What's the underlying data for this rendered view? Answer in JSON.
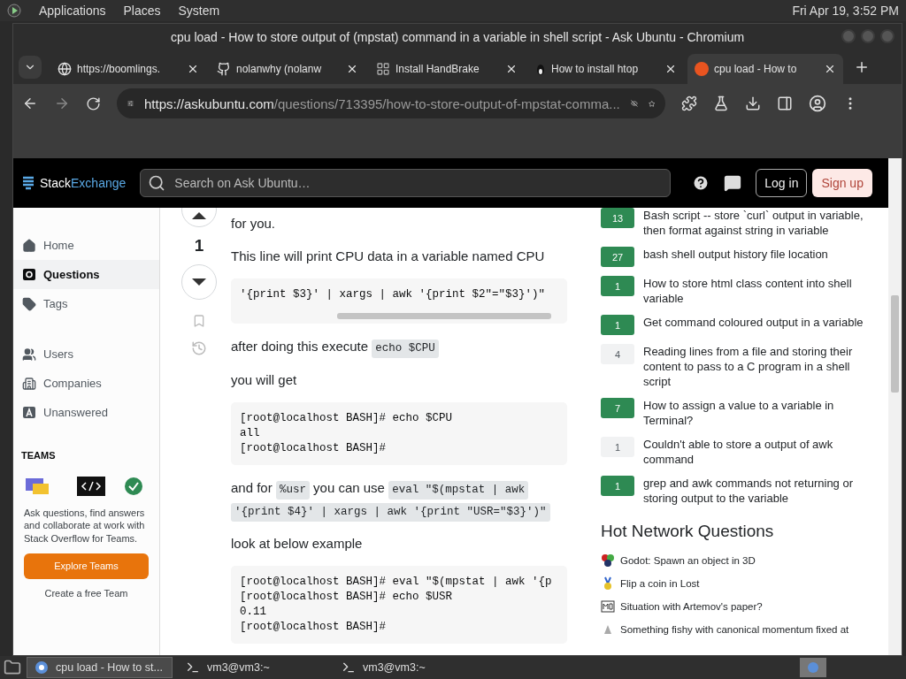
{
  "top_panel": {
    "menus": [
      "Applications",
      "Places",
      "System"
    ],
    "clock": "Fri Apr 19,  3:52 PM"
  },
  "window": {
    "title": "cpu load - How to store output of (mpstat) command in a variable in shell script - Ask Ubuntu - Chromium"
  },
  "tabs": [
    {
      "label": "https://boomlings.",
      "selected": false
    },
    {
      "label": "nolanwhy (nolanw",
      "selected": false
    },
    {
      "label": "Install HandBrake",
      "selected": false
    },
    {
      "label": "How to install htop",
      "selected": false
    },
    {
      "label": "cpu load - How to",
      "selected": true
    }
  ],
  "address": {
    "host": "https://askubuntu.com",
    "path": "/questions/713395/how-to-store-output-of-mpstat-comma..."
  },
  "site_header": {
    "logo_a": "Stack",
    "logo_b": "Exchange",
    "search_placeholder": "Search on Ask Ubuntu…",
    "login": "Log in",
    "signup": "Sign up"
  },
  "sidebar": {
    "groups": [
      [
        {
          "label": "Home",
          "selected": false
        },
        {
          "label": "Questions",
          "selected": true
        },
        {
          "label": "Tags",
          "selected": false
        }
      ],
      [
        {
          "label": "Users",
          "selected": false
        },
        {
          "label": "Companies",
          "selected": false
        },
        {
          "label": "Unanswered",
          "selected": false
        }
      ]
    ],
    "teams": {
      "heading": "TEAMS",
      "text": "Ask questions, find answers and collaborate at work with Stack Overflow for Teams.",
      "button": "Explore Teams",
      "link": "Create a free Team"
    }
  },
  "answer": {
    "votes": "1",
    "blocks": [
      {
        "kind": "p",
        "parts": [
          {
            "kind": "text",
            "text": "for you."
          }
        ]
      },
      {
        "kind": "p",
        "parts": [
          {
            "kind": "text",
            "text": "This line will print CPU data in a variable named CPU"
          }
        ]
      },
      {
        "kind": "pre",
        "scrollbar": true,
        "lines": [
          "'{print $3}' | xargs | awk '{print $2\"=\"$3}')\""
        ]
      },
      {
        "kind": "p",
        "parts": [
          {
            "kind": "text",
            "text": "after doing this execute "
          },
          {
            "kind": "code",
            "text": "echo $CPU"
          }
        ]
      },
      {
        "kind": "p",
        "parts": [
          {
            "kind": "text",
            "text": "you will get"
          }
        ]
      },
      {
        "kind": "pre",
        "scrollbar": false,
        "lines": [
          "[root@localhost BASH]# echo $CPU",
          "all",
          "[root@localhost BASH]#"
        ]
      },
      {
        "kind": "p",
        "parts": [
          {
            "kind": "text",
            "text": "and for "
          },
          {
            "kind": "code",
            "text": "%usr"
          },
          {
            "kind": "text",
            "text": " you can use "
          },
          {
            "kind": "code",
            "text": "eval \"$(mpstat | awk"
          },
          {
            "kind": "code",
            "text": "'{print $4}' | xargs | awk '{print \"USR=\"$3}')\""
          }
        ]
      },
      {
        "kind": "p",
        "parts": [
          {
            "kind": "text",
            "text": "look at below example"
          }
        ]
      },
      {
        "kind": "pre",
        "scrollbar": false,
        "lines": [
          "[root@localhost BASH]# eval \"$(mpstat | awk '{p",
          "[root@localhost BASH]# echo $USR",
          "0.11",
          "[root@localhost BASH]#"
        ]
      }
    ]
  },
  "related": [
    {
      "score": "13",
      "answered": true,
      "title": "Bash script -- store `curl` output in variable, then format against string in variable"
    },
    {
      "score": "27",
      "answered": true,
      "title": "bash shell output history file location"
    },
    {
      "score": "1",
      "answered": true,
      "title": "How to store html class content into shell variable"
    },
    {
      "score": "1",
      "answered": true,
      "title": "Get command coloured output in a variable"
    },
    {
      "score": "4",
      "answered": false,
      "title": "Reading lines from a file and storing their content to pass to a C program in a shell script"
    },
    {
      "score": "7",
      "answered": true,
      "title": "How to assign a value to a variable in Terminal?"
    },
    {
      "score": "1",
      "answered": false,
      "title": "Couldn't able to store a output of awk command"
    },
    {
      "score": "1",
      "answered": true,
      "title": "grep and awk commands not returning or storing output to the variable"
    }
  ],
  "hot_network": {
    "heading": "Hot Network Questions",
    "items": [
      {
        "title": "Godot: Spawn an object in 3D"
      },
      {
        "title": "Flip a coin in Lost"
      },
      {
        "title": "Situation with Artemov's paper?"
      },
      {
        "title": "Something fishy with canonical momentum fixed at"
      }
    ]
  },
  "taskbar": [
    {
      "label": "cpu load - How to st...",
      "selected": true
    },
    {
      "label": "vm3@vm3:~",
      "selected": false
    },
    {
      "label": "vm3@vm3:~",
      "selected": false
    }
  ]
}
